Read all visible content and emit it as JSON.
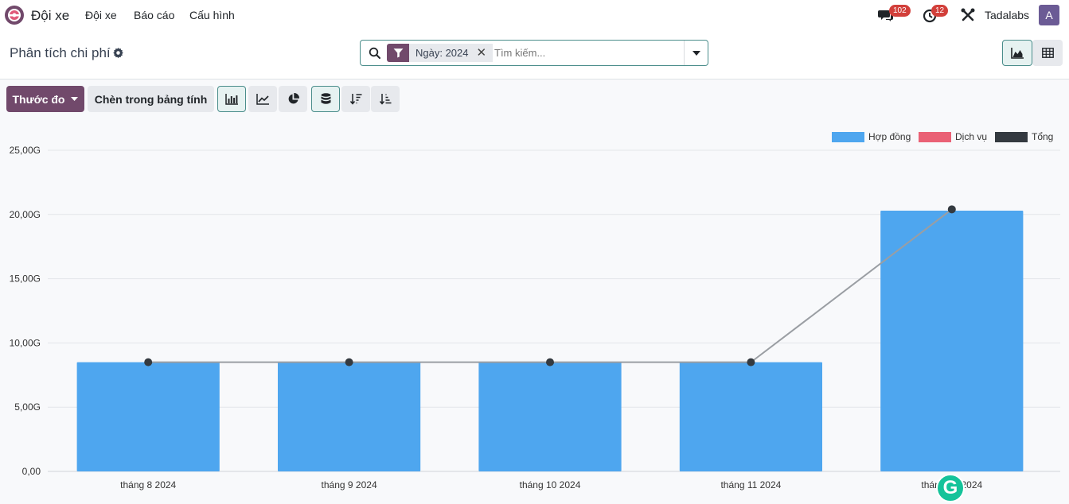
{
  "navbar": {
    "app_name": "Đội xe",
    "menu": [
      "Đội xe",
      "Báo cáo",
      "Cấu hình"
    ],
    "messages_badge": "102",
    "activities_badge": "12",
    "company": "Tadalabs",
    "avatar_letter": "A"
  },
  "control_panel": {
    "title": "Phân tích chi phí",
    "facet_value": "Ngày: 2024",
    "search_placeholder": "Tìm kiếm..."
  },
  "toolbar": {
    "measures_label": "Thước đo",
    "insert_label": "Chèn trong bảng tính"
  },
  "colors": {
    "brand": "#71496b",
    "accent": "#4a8d8b",
    "contract": "#4ea6ef",
    "service": "#ea6175",
    "total": "#343a40"
  },
  "chart_data": {
    "type": "bar",
    "categories": [
      "tháng 8 2024",
      "tháng 9 2024",
      "tháng 10 2024",
      "tháng 11 2024",
      "tháng 12 2024"
    ],
    "series": [
      {
        "name": "Hợp đồng",
        "type": "bar",
        "values": [
          8.5,
          8.5,
          8.5,
          8.5,
          20.3
        ]
      },
      {
        "name": "Dịch vụ",
        "type": "bar",
        "values": [
          0,
          0,
          0,
          0,
          0
        ]
      },
      {
        "name": "Tổng",
        "type": "line",
        "values": [
          8.5,
          8.5,
          8.5,
          8.5,
          20.4
        ]
      }
    ],
    "yticks": [
      "0,00",
      "5,00G",
      "10,00G",
      "15,00G",
      "20,00G",
      "25,00G"
    ],
    "ylim": [
      0,
      25
    ],
    "grid": true,
    "legend": "top-right"
  }
}
